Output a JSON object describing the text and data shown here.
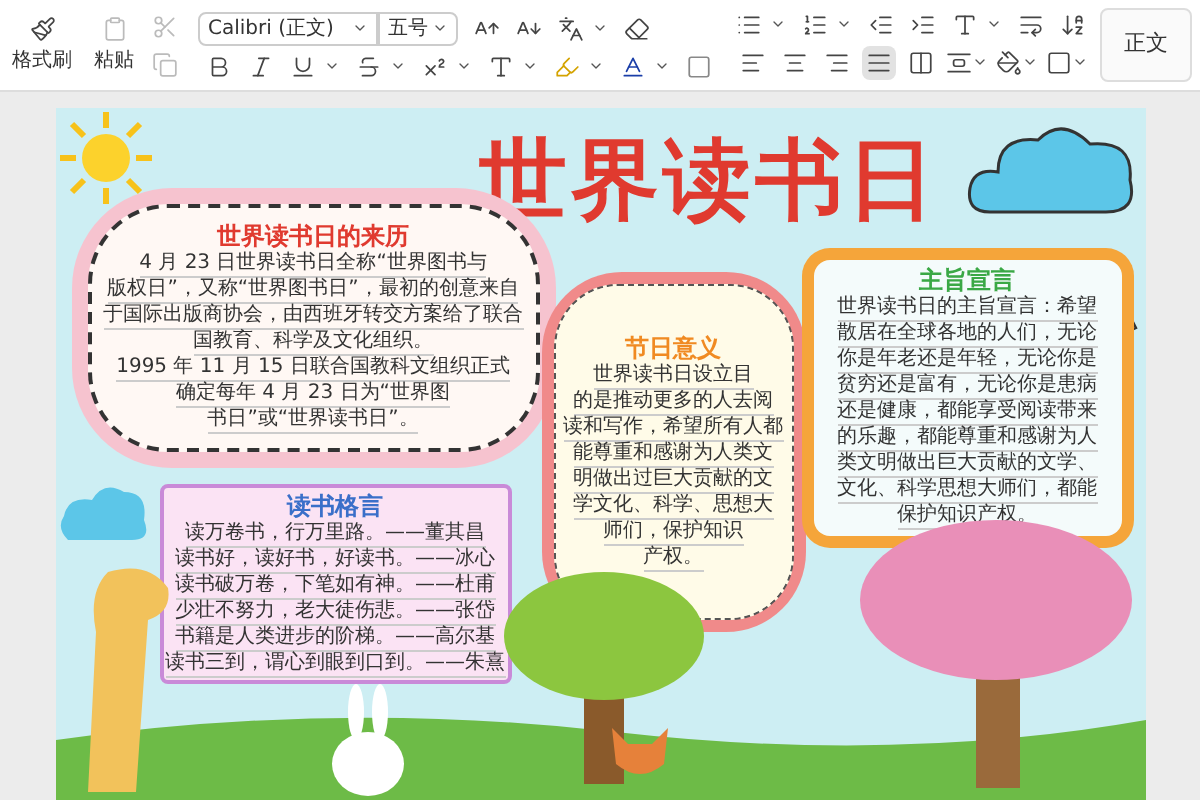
{
  "ribbon": {
    "format_painter": {
      "label": "格式刷"
    },
    "paste": {
      "label": "粘贴"
    },
    "font": {
      "value": "Calibri (正文)"
    },
    "size": {
      "value": "五号"
    },
    "align_buttons": [
      {
        "kind": "left",
        "selected": false
      },
      {
        "kind": "center",
        "selected": false
      },
      {
        "kind": "right",
        "selected": false
      },
      {
        "kind": "justify",
        "selected": true
      },
      {
        "kind": "distributed",
        "selected": false
      }
    ],
    "style": {
      "label": "正文"
    }
  },
  "poster": {
    "title": "世界读书日",
    "sections": [
      {
        "kind": "history",
        "title": "世界读书日的来历",
        "lines": [
          "4 月 23 日世界读书日全称“世界图书与",
          "版权日”，又称“世界图书日”，最初的创意来自",
          "于国际出版商协会，由西班牙转交方案给了联合",
          "国教育、科学及文化组织。",
          "1995 年 11 月 15 日联合国教科文组织正式",
          "确定每年 4 月 23 日为“世界图",
          "书日”或“世界读书日”。"
        ]
      },
      {
        "kind": "meaning",
        "title": "节日意义",
        "lines": [
          "世界读书日设立目",
          "的是推动更多的人去阅",
          "读和写作，希望所有人都",
          "能尊重和感谢为人类文",
          "明做出过巨大贡献的文",
          "学文化、科学、思想大",
          "师们，保护知识",
          "产权。"
        ]
      },
      {
        "kind": "declaration",
        "title": "主旨宣言",
        "lines": [
          "世界读书日的主旨宣言：希望",
          "散居在全球各地的人们，无论",
          "你是年老还是年轻，无论你是",
          "贫穷还是富有，无论你是患病",
          "还是健康，都能享受阅读带来",
          "的乐趣，都能尊重和感谢为人",
          "类文明做出巨大贡献的文学、",
          "文化、科学思想大师们，都能",
          "保护知识产权。"
        ]
      },
      {
        "kind": "quotes",
        "title": "读书格言",
        "lines": [
          "读万卷书，行万里路。——董其昌",
          "读书好，读好书，好读书。——冰心",
          "读书破万卷，下笔如有神。——杜甫",
          "少壮不努力，老大徒伤悲。——张岱",
          "书籍是人类进步的阶梯。——高尔基",
          "读书三到，谓心到眼到口到。——朱熹"
        ]
      }
    ]
  }
}
